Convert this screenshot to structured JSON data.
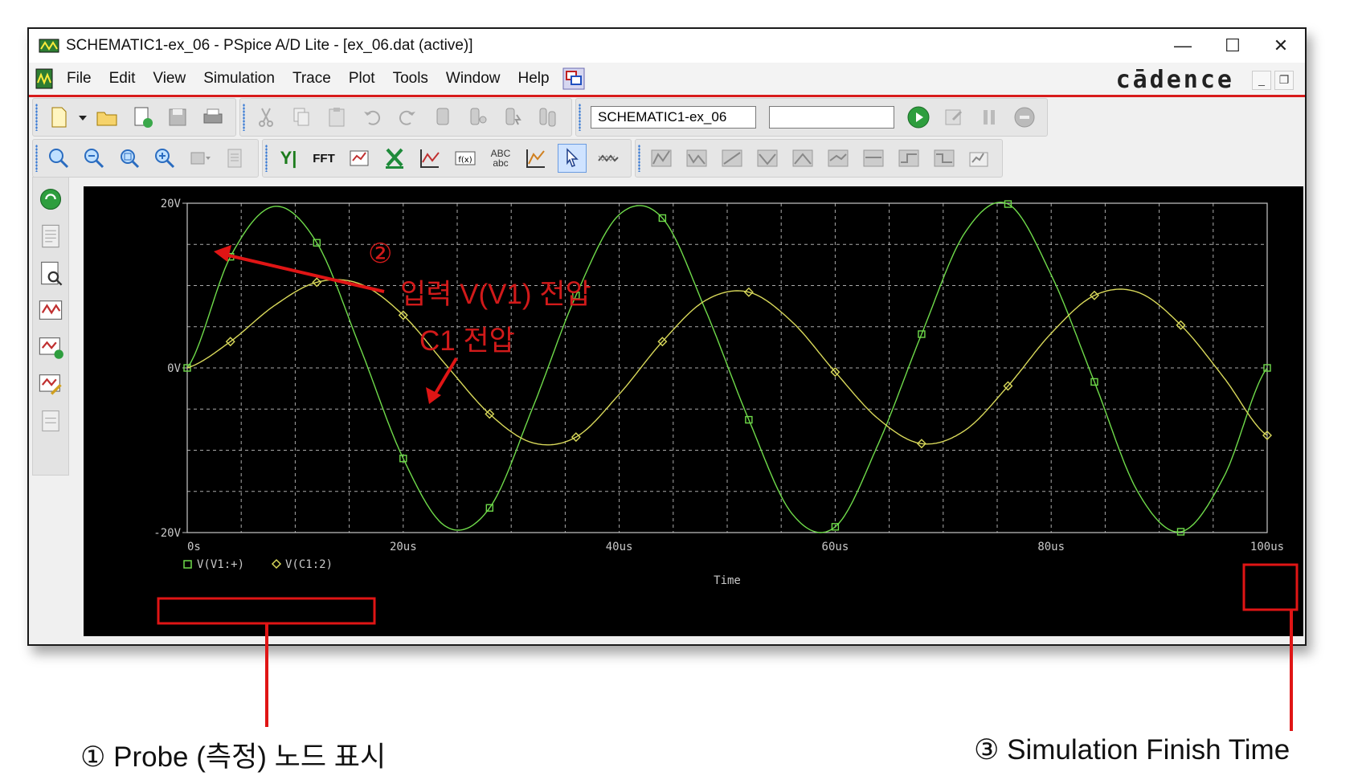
{
  "window": {
    "title": "SCHEMATIC1-ex_06 - PSpice A/D Lite - [ex_06.dat (active)]",
    "controls": {
      "minimize": "—",
      "maximize": "☐",
      "close": "✕"
    }
  },
  "menu": {
    "items": [
      "File",
      "Edit",
      "View",
      "Simulation",
      "Trace",
      "Plot",
      "Tools",
      "Window",
      "Help"
    ],
    "brand": "cādence",
    "mdi": {
      "minimize": "_",
      "restore": "❐"
    }
  },
  "toolbar": {
    "profile_value": "SCHEMATIC1-ex_06",
    "second_combo_value": "",
    "row1_icons": [
      "new-file-icon",
      "dropdown-arrow-icon",
      "open-folder-icon",
      "open-simulation-icon",
      "save-icon",
      "print-icon",
      "cut-icon",
      "copy-icon",
      "paste-icon",
      "undo-icon",
      "redo-icon",
      "marker-voltage-icon",
      "marker-current-icon",
      "marker-power-icon",
      "marker-diff-icon"
    ],
    "run_icon": "run-play-icon",
    "row1_right_icons": [
      "edit-profile-icon",
      "pause-icon",
      "stop-icon"
    ],
    "row2_icons": [
      "zoom-in-icon",
      "zoom-out-icon",
      "zoom-area-icon",
      "zoom-fit-icon",
      "axis-settings-icon",
      "copy-plot-icon"
    ],
    "row2_labels": {
      "y_axis": "Y|",
      "fft": "FFT",
      "abc": "ABC",
      "abc_lower": "abc"
    },
    "row2_more_icons": [
      "add-plot-icon",
      "excel-export-icon",
      "add-trace-icon",
      "eval-measure-icon",
      "text-label-icon",
      "toggle-cursor-icon",
      "select-pointer-icon",
      "mark-data-points-icon"
    ],
    "row2_right_icons": [
      "peak-icon",
      "trough-icon",
      "slope-icon",
      "min-icon",
      "max-icon",
      "point-icon",
      "search-next-icon",
      "next-transition-icon",
      "prev-transition-icon",
      "cursor-settings-icon"
    ]
  },
  "sidebar": {
    "icons": [
      "simulation-status-icon",
      "output-file-icon",
      "view-output-icon",
      "plot-window-icon",
      "run-plot-icon",
      "edit-plot-icon",
      "measurements-icon"
    ]
  },
  "plot": {
    "background": "#000000",
    "grid_color": "#c8c8c8",
    "axis_text_color": "#c8c8c8",
    "y_tick_labels": [
      "20V",
      "0V",
      "-20V"
    ],
    "x_tick_labels": [
      "0s",
      "20us",
      "40us",
      "60us",
      "80us",
      "100us"
    ],
    "x_axis_title": "Time",
    "legend": [
      {
        "marker": "□",
        "label": "V(V1:+)",
        "color": "#6fdb4a"
      },
      {
        "marker": "◇",
        "label": "V(C1:2)",
        "color": "#d9d95a"
      }
    ]
  },
  "chart_data": {
    "type": "line",
    "xlabel": "Time",
    "ylabel": "",
    "xlim": [
      0,
      100
    ],
    "x_unit": "us",
    "ylim": [
      -20,
      20
    ],
    "y_unit": "V",
    "grid": true,
    "legend_position": "bottom-left",
    "series": [
      {
        "name": "V(V1:+)",
        "color": "#6fdb4a",
        "marker": "square",
        "amplitude": 20,
        "frequency_khz": 30,
        "phase_deg": 0,
        "x": [
          0,
          4,
          8,
          12,
          16,
          20,
          24,
          28,
          32,
          36,
          40,
          44,
          48,
          52,
          56,
          60,
          64,
          68,
          72,
          76,
          80,
          84,
          88,
          92,
          96,
          100
        ],
        "y": [
          0,
          13.5,
          19.6,
          15.2,
          2.5,
          -11,
          -19.3,
          -17,
          -4.8,
          8.8,
          18.6,
          18.2,
          7,
          -6.3,
          -17.7,
          -19.3,
          -9.2,
          4.1,
          16.4,
          19.9,
          11.3,
          -1.7,
          -15,
          -19.9,
          -13.2,
          0
        ]
      },
      {
        "name": "V(C1:2)",
        "color": "#d9d95a",
        "marker": "diamond",
        "x": [
          0,
          4,
          8,
          12,
          16,
          20,
          24,
          28,
          32,
          36,
          40,
          44,
          48,
          52,
          56,
          60,
          64,
          68,
          72,
          76,
          80,
          84,
          88,
          92,
          96,
          100
        ],
        "y": [
          0,
          3.2,
          7.5,
          10.4,
          10.2,
          6.4,
          0.3,
          -5.6,
          -9.1,
          -8.4,
          -3.2,
          3.2,
          8.2,
          9.2,
          5.6,
          -0.5,
          -6.2,
          -9.2,
          -7.6,
          -2.2,
          4.2,
          8.8,
          9.2,
          5.2,
          -1.2,
          -8.2
        ]
      }
    ]
  },
  "annotations": {
    "input_voltage_number": "②",
    "input_voltage_label": "입력 V(V1) 전압",
    "c1_voltage_label": "C1 전압",
    "probe_note": "① Probe (측정) 노드 표시",
    "finish_note": "③ Simulation Finish Time",
    "highlight_color": "#e01515"
  }
}
